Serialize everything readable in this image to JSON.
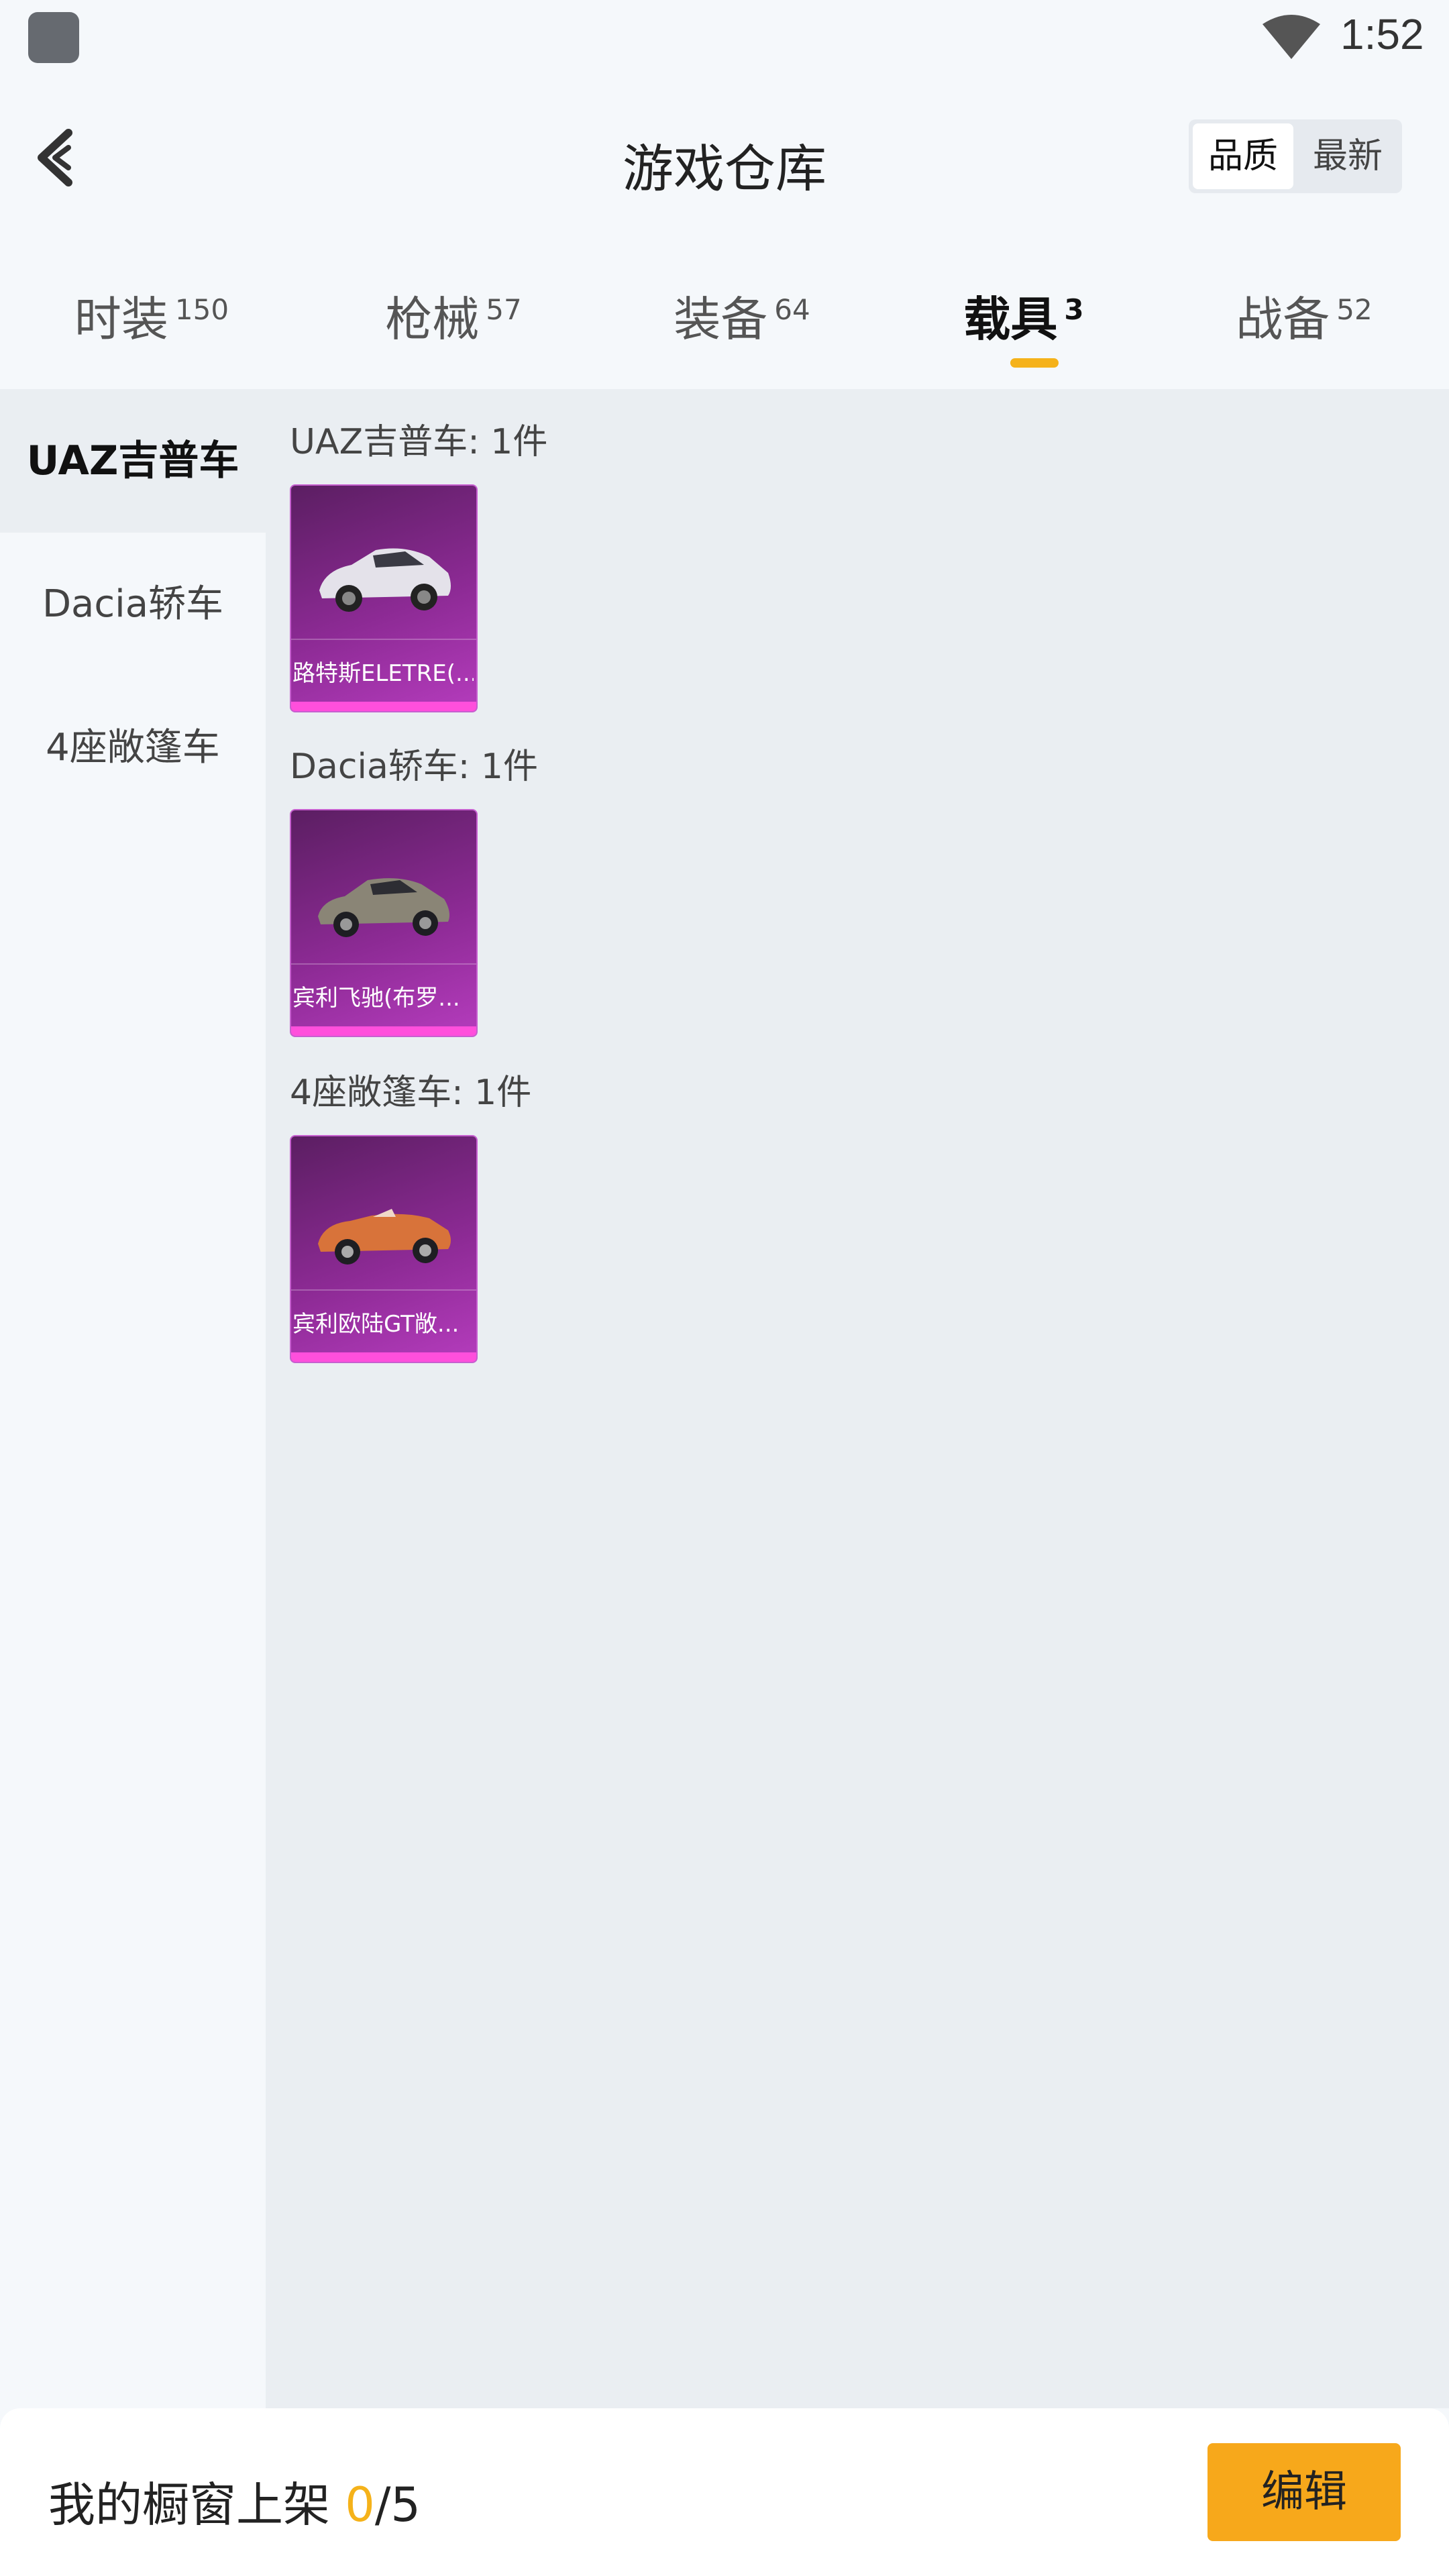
{
  "status": {
    "time": "1:52"
  },
  "header": {
    "title": "游戏仓库",
    "sort": [
      "品质",
      "最新"
    ]
  },
  "tabs": [
    {
      "label": "时装",
      "count": "150"
    },
    {
      "label": "枪械",
      "count": "57"
    },
    {
      "label": "装备",
      "count": "64"
    },
    {
      "label": "载具",
      "count": "3"
    },
    {
      "label": "战备",
      "count": "52"
    }
  ],
  "active_tab": "载具",
  "sidebar": {
    "items": [
      "UAZ吉普车",
      "Dacia轿车",
      "4座敞篷车"
    ]
  },
  "groups": [
    {
      "title": "UAZ吉普车: 1件",
      "item": "路特斯ELETRE(..."
    },
    {
      "title": "Dacia轿车: 1件",
      "item": "宾利飞驰(布罗..."
    },
    {
      "title": "4座敞篷车: 1件",
      "item": "宾利欧陆GT敞..."
    }
  ],
  "footer": {
    "label": "我的橱窗上架 ",
    "current": "0",
    "total": "/5",
    "edit": "编辑"
  },
  "colors": {
    "accent": "#f5b21a",
    "button": "#f7a81b",
    "card": "#8c2a94"
  }
}
